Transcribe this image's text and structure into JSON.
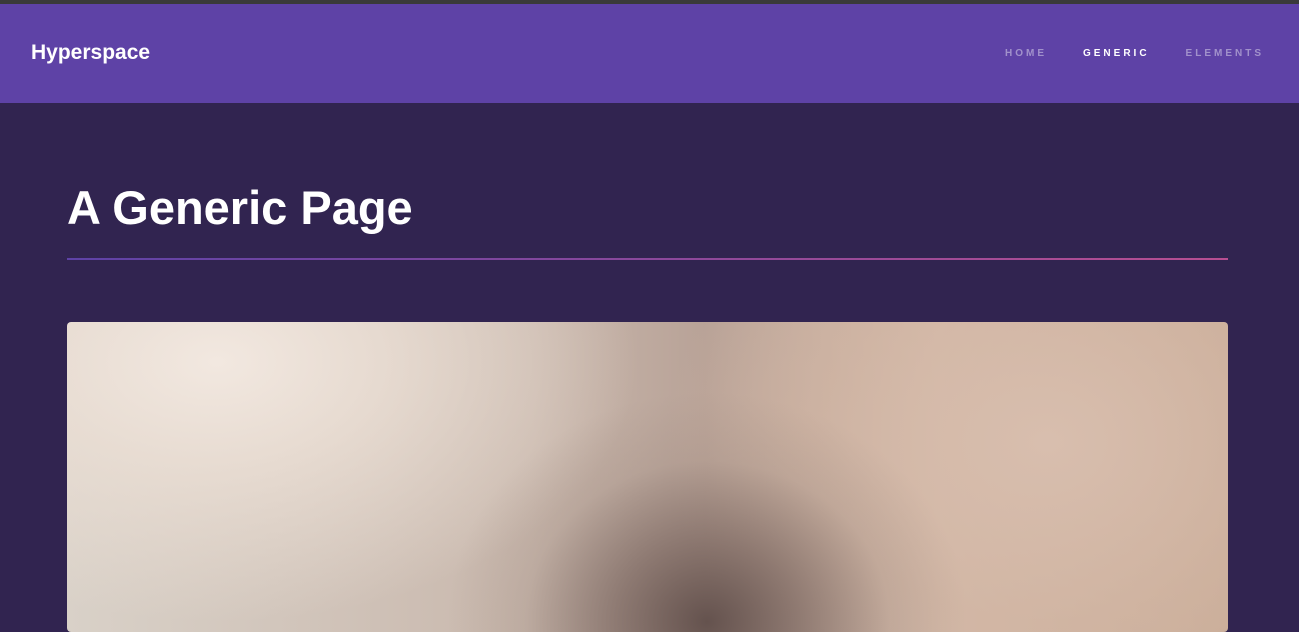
{
  "header": {
    "brand": "Hyperspace",
    "nav": [
      {
        "label": "Home",
        "active": false
      },
      {
        "label": "Generic",
        "active": true
      },
      {
        "label": "Elements",
        "active": false
      }
    ]
  },
  "main": {
    "title": "A Generic Page"
  },
  "colors": {
    "background": "#312450",
    "header": "#5e42a6",
    "divider_start": "#5e42a6",
    "divider_end": "#b74e91"
  }
}
